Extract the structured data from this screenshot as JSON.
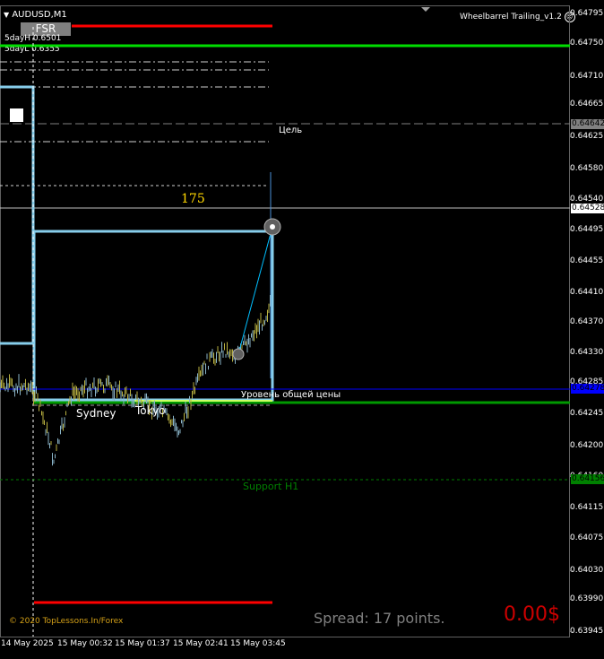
{
  "symbol": "AUDUSD,M1",
  "ea_name": "Wheelbarrel Trailing_v1.2",
  "fsr_label": "FSR",
  "day_high": "5dayH 0.6501",
  "day_low": "5dayL 0.6355",
  "target_label": "Цель",
  "pips_label": "175",
  "avg_price_label": "Уровень общей цены",
  "support_label": "Support H1",
  "session_sydney": "Sydney",
  "session_tokyo": "Tokyo",
  "copyright": "© 2020 TopLessons.In/Forex",
  "spread_text": "Spread: 17 points.",
  "profit_text": "0.00$",
  "price_axis": {
    "labels": [
      "0.64795",
      "0.64750",
      "0.64710",
      "0.64665",
      "0.64625",
      "0.64580",
      "0.64540",
      "0.64495",
      "0.64455",
      "0.64410",
      "0.64370",
      "0.64330",
      "0.64285",
      "0.64245",
      "0.64200",
      "0.64160",
      "0.64115",
      "0.64075",
      "0.64030",
      "0.63990",
      "0.63945"
    ],
    "boxes": {
      "target": "0.64642",
      "current": "0.64528",
      "average": "0.64278",
      "support": "0.64156"
    }
  },
  "time_axis": [
    "14 May 2025",
    "15 May 00:32",
    "15 May 01:37",
    "15 May 02:41",
    "15 May 03:45"
  ],
  "colors": {
    "background": "#000000",
    "candles": "#b8b040",
    "bull": "#8ab4c8",
    "red_line": "#ff0000",
    "green_line": "#00cc00",
    "avg_line": "#0000ff",
    "support": "#008000",
    "position_box": "#87ceeb",
    "target_box": "#808080",
    "profit": "#cc0000",
    "spread": "#808080",
    "copyright": "#d4a017"
  }
}
